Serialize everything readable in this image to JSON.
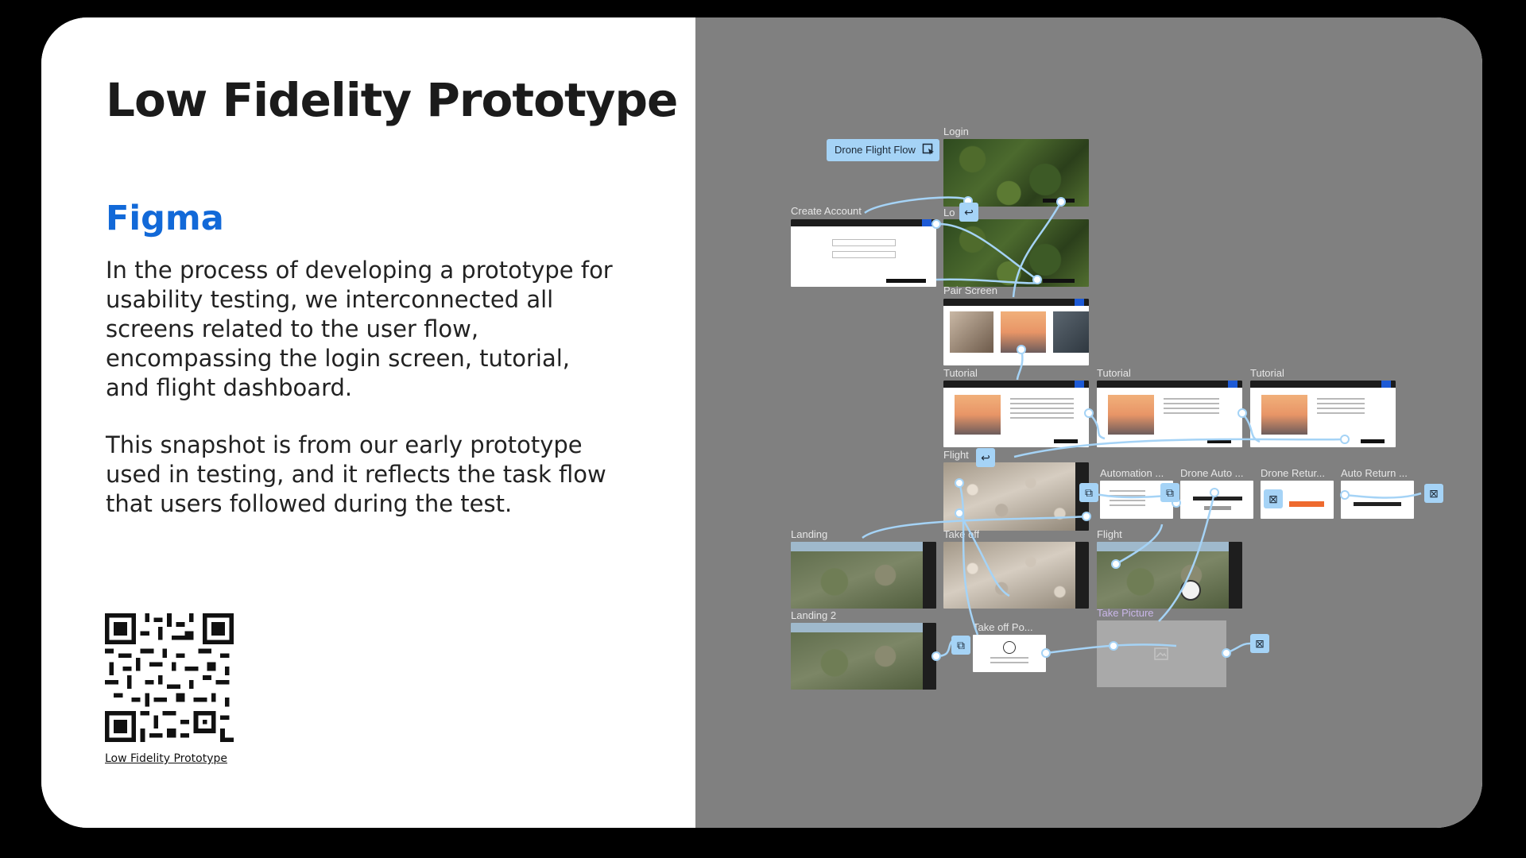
{
  "slide": {
    "title": "Low Fidelity Prototype",
    "subtitle": "Figma",
    "paragraph1": "In the process of developing a prototype for usability testing, we interconnected all screens related to the user flow, encompassing the login screen, tutorial, and flight dashboard.",
    "paragraph2": "This snapshot is from our early prototype used in testing, and it reflects the task flow that users followed during the test.",
    "qr_caption": "Low Fidelity Prototype"
  },
  "canvas": {
    "flow_name": "Drone Flight Flow",
    "frames": {
      "login": "Login",
      "login2": "Lo",
      "create_account": "Create Account",
      "pair_screen": "Pair Screen",
      "tutorial1": "Tutorial",
      "tutorial2": "Tutorial",
      "tutorial3": "Tutorial",
      "flight": "Flight",
      "automation": "Automation ...",
      "drone_auto": "Drone Auto ...",
      "drone_return": "Drone Retur...",
      "auto_return": "Auto Return ...",
      "landing": "Landing",
      "take_off": "Take off",
      "flight2": "Flight",
      "landing2": "Landing 2",
      "take_off_popup": "Take off Po...",
      "take_picture": "Take Picture"
    }
  },
  "colors": {
    "heading": "#1b1b1b",
    "accent": "#1269d8",
    "canvas": "#808080",
    "prototype_wire": "#a5d3f6"
  }
}
